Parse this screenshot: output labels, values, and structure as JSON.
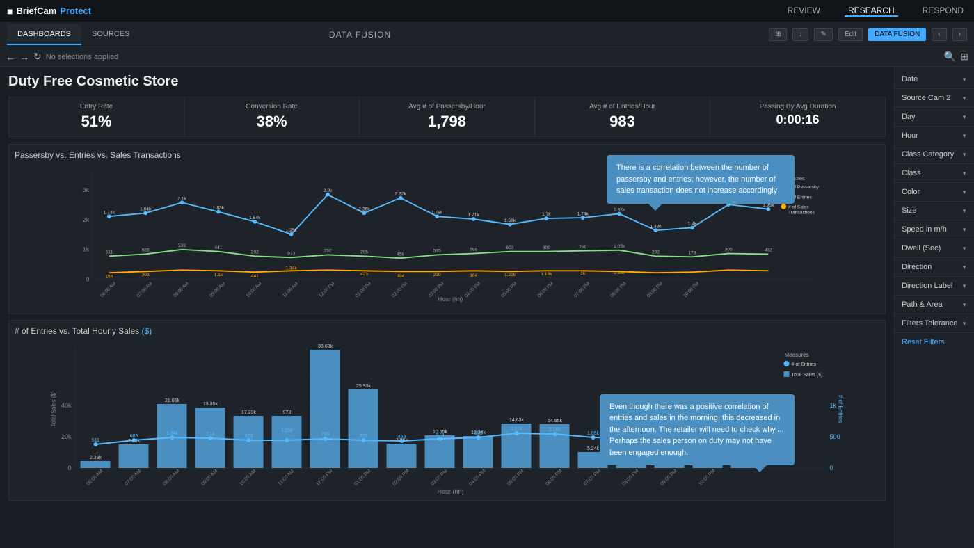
{
  "app": {
    "logo": "BriefCam",
    "protect": "Protect",
    "nav": [
      "REVIEW",
      "RESEARCH",
      "RESPOND"
    ],
    "active_nav": "RESEARCH"
  },
  "sub_nav": {
    "tabs": [
      "DASHBOARDS",
      "SOURCES"
    ],
    "active_tab": "DASHBOARDS",
    "center_label": "DATA FUSION",
    "toolbar": [
      "Edit",
      "DATA FUSION"
    ]
  },
  "filter_bar": {
    "text": "No selections applied"
  },
  "dashboard": {
    "title": "Duty Free Cosmetic Store",
    "stats": [
      {
        "label": "Entry Rate",
        "value": "51%"
      },
      {
        "label": "Conversion Rate",
        "value": "38%"
      },
      {
        "label": "Avg # of Passersby/Hour",
        "value": "1,798"
      },
      {
        "label": "Avg # of Entries/Hour",
        "value": "983"
      },
      {
        "label": "Passing By Avg Duration",
        "value": "0:00:16"
      }
    ]
  },
  "chart1": {
    "title": "Passersby vs. Entries vs. Sales Transactions",
    "x_label": "Hour (hh)",
    "legend": [
      {
        "label": "# of Passersby",
        "color": "#5bf"
      },
      {
        "label": "# of Entries",
        "color": "#8d8"
      },
      {
        "label": "# of Sales Transactions",
        "color": "#fa0"
      }
    ],
    "tooltip": "There is a correlation between the number of passersby and entries; however, the number of sales transaction does not increase accordingly"
  },
  "chart2": {
    "title": "# of Entries vs. Total Hourly Sales",
    "unit": "($)",
    "x_label": "Hour (hh)",
    "legend": [
      {
        "label": "# of Entries",
        "color": "#5bf"
      },
      {
        "label": "Total Sales ($)",
        "color": "#4af"
      }
    ],
    "tooltip": "Even though there was a positive correlation of entries and sales in the morning, this decreased in the afternoon. The retailer will need to check why.... Perhaps the sales person on duty may not have been engaged enough."
  },
  "right_panel": {
    "filters": [
      {
        "label": "Date"
      },
      {
        "label": "Source Cam 2"
      },
      {
        "label": "Day"
      },
      {
        "label": "Hour"
      },
      {
        "label": "Class Category"
      },
      {
        "label": "Class"
      },
      {
        "label": "Color"
      },
      {
        "label": "Size"
      },
      {
        "label": "Speed in m/h"
      },
      {
        "label": "Dwell (Sec)"
      },
      {
        "label": "Direction"
      },
      {
        "label": "Direction Label"
      },
      {
        "label": "Path & Area"
      },
      {
        "label": "Filters Tolerance"
      }
    ],
    "reset": "Reset Filters"
  }
}
